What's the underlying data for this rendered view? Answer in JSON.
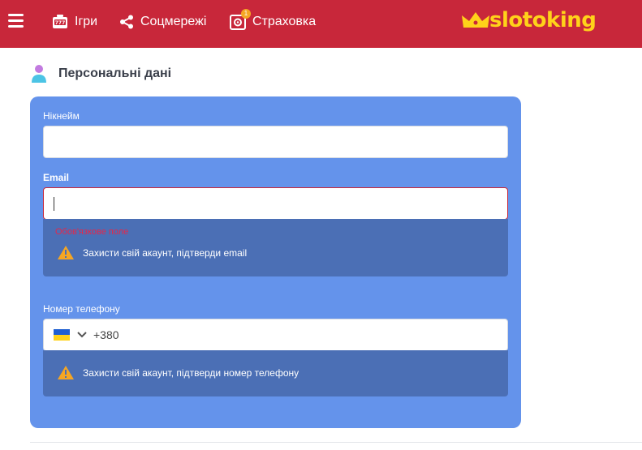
{
  "header": {
    "nav": {
      "games": "Ігри",
      "social": "Соцмережі",
      "insurance": "Страховка",
      "insurance_badge": "1"
    },
    "logo": "slotoking",
    "colors": {
      "bar": "#c8273a",
      "logo": "#ffd21a"
    }
  },
  "section": {
    "title": "Персональні дані"
  },
  "form": {
    "nickname": {
      "label": "Нікнейм",
      "value": ""
    },
    "email": {
      "label": "Email",
      "value": "",
      "error": "Обов'язкове поле",
      "warning": "Захисти свій акаунт, підтверди email"
    },
    "phone": {
      "label": "Номер телефону",
      "country": "UA",
      "value": "+380",
      "warning": "Захисти свій акаунт, підтверди номер телефону"
    }
  },
  "colors": {
    "card": "#6493eb",
    "panel": "#4b6fb5",
    "error": "#e5274a",
    "warning": "#f5a623"
  }
}
